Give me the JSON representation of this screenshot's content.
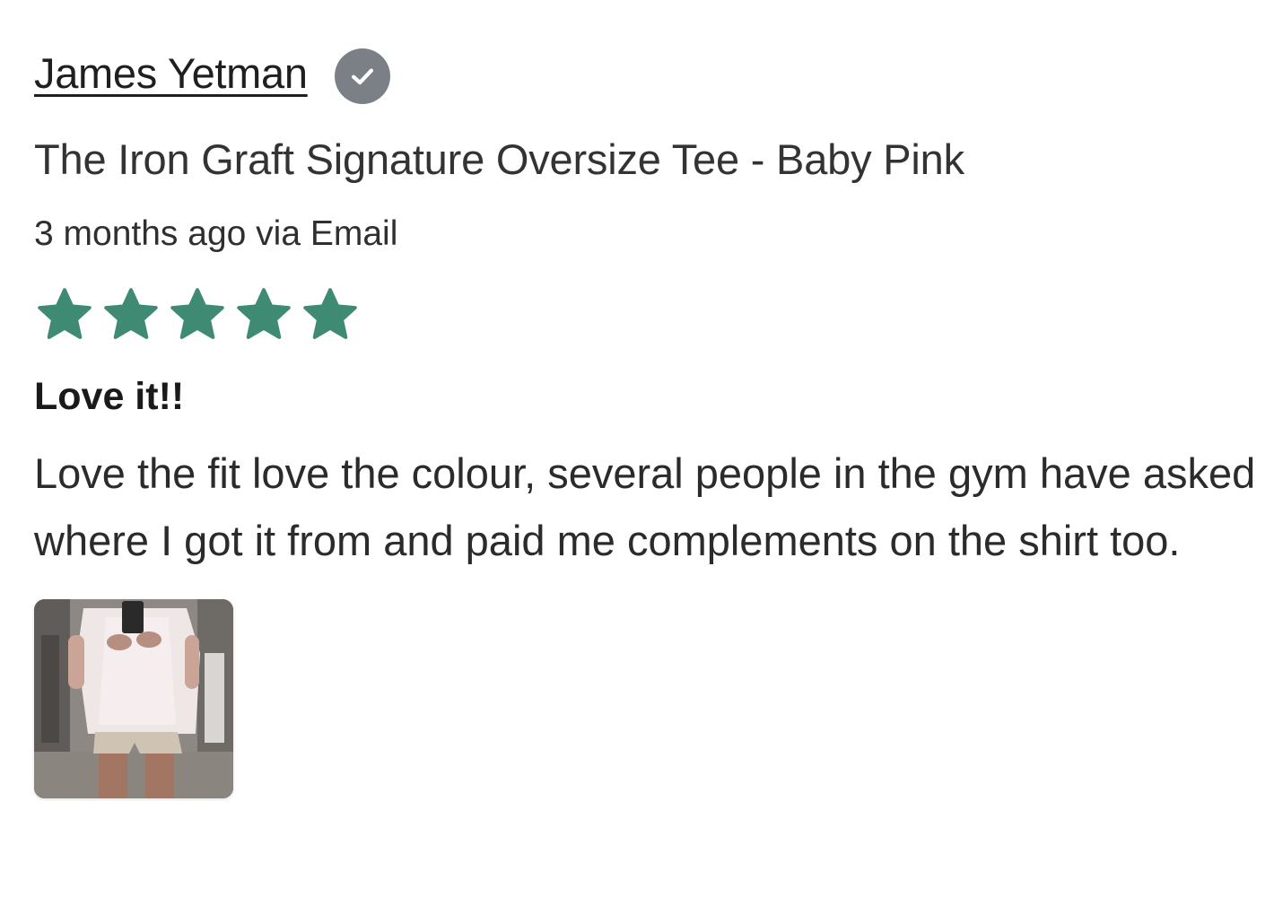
{
  "review": {
    "author": "James Yetman",
    "verified_icon": "verified-check-icon",
    "product_title": "The Iron Graft Signature Oversize Tee - Baby Pink",
    "meta": "3 months ago via Email",
    "rating": 5,
    "rating_max": 5,
    "star_color": "#3e8a72",
    "title": "Love it!!",
    "body": "Love the fit love the colour, several people in the gym have asked where I got it from and paid me complements on the shirt too.",
    "photo_icon": "review-photo-thumbnail"
  }
}
